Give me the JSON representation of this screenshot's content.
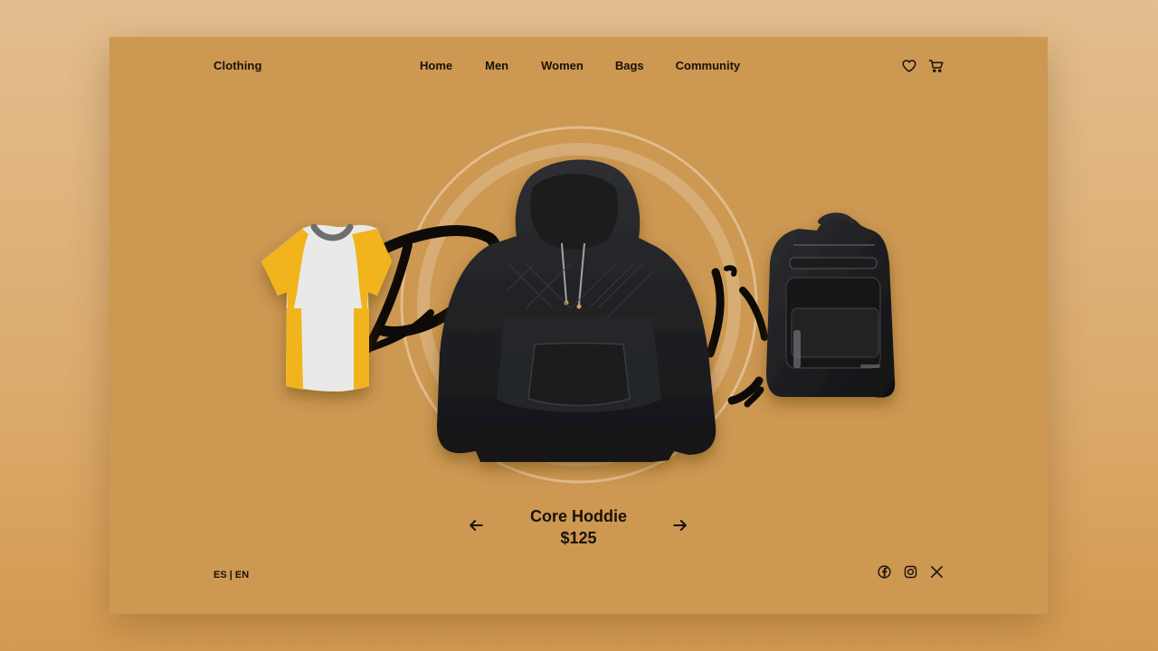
{
  "brand": "Clothing",
  "nav": {
    "items": [
      "Home",
      "Men",
      "Women",
      "Bags",
      "Community"
    ]
  },
  "header_icons": [
    "heart-icon",
    "cart-icon"
  ],
  "product": {
    "name": "Core Hoddie",
    "price": "$125"
  },
  "language": {
    "es": "ES",
    "separator": "|",
    "en": "EN"
  },
  "social": [
    "facebook-icon",
    "instagram-icon",
    "x-icon"
  ],
  "colors": {
    "background": "#cc9852",
    "text": "#1a1208",
    "tshirt_accent": "#f1b41a"
  }
}
